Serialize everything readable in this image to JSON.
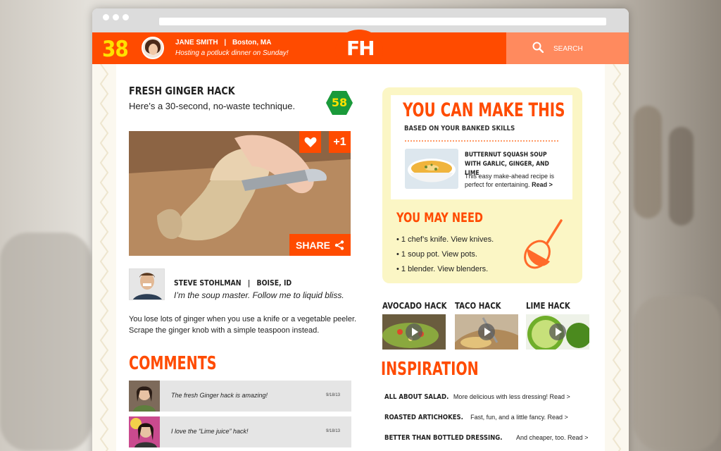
{
  "header": {
    "score": "38",
    "user_name": "JANE SMITH",
    "user_separator": "|",
    "user_location": "Boston, MA",
    "user_status": "Hosting a potluck dinner on Sunday!",
    "logo": "FH",
    "search_label": "SEARCH"
  },
  "hack": {
    "title": "FRESH GINGER HACK",
    "subtitle": "Here’s a 30-second, no-waste technique.",
    "score": "58",
    "plus_one": "+1",
    "share_label": "SHARE",
    "author_name": "STEVE STOHLMAN",
    "author_separator": "|",
    "author_location": "BOISE, ID",
    "author_quote": "I’m the soup master. Follow me to liquid bliss.",
    "body": "You lose lots of ginger when you use a knife or a vegetable peeler. Scrape the ginger knob with a simple teaspoon instead."
  },
  "comments": {
    "title": "COMMENTS",
    "items": [
      {
        "text": "The fresh Ginger hack is amazing!",
        "date": "9/18/13"
      },
      {
        "text": "I love the “Lime juice” hack!",
        "date": "9/18/13"
      }
    ]
  },
  "make": {
    "title": "YOU CAN MAKE THIS",
    "subtitle": "BASED ON YOUR BANKED SKILLS",
    "recipe_title": "BUTTERNUT SQUASH SOUP WITH GARLIC, GINGER, AND LIME",
    "recipe_desc": "This easy make-ahead recipe is perfect for entertaining.",
    "recipe_link": "Read >",
    "need_title": "YOU MAY NEED",
    "need_items": [
      "• 1 chef’s knife. View knives.",
      "• 1 soup pot. View pots.",
      "• 1 blender. View blenders."
    ]
  },
  "hacks": [
    {
      "title": "AVOCADO HACK"
    },
    {
      "title": "TACO HACK"
    },
    {
      "title": "LIME HACK"
    }
  ],
  "inspiration": {
    "title": "INSPIRATION",
    "items": [
      {
        "title": "ALL ABOUT SALAD.",
        "text": "More delicious with less dressing! Read >"
      },
      {
        "title": "ROASTED ARTICHOKES.",
        "text": "Fast, fun, and a little fancy. Read >"
      },
      {
        "title": "BETTER THAN BOTTLED DRESSING.",
        "text": "And cheaper, too. Read >"
      }
    ]
  },
  "colors": {
    "accent": "#ff4b00",
    "highlight": "#ffe100",
    "panel": "#fbf6c5",
    "score_badge": "#1a9a3a"
  }
}
